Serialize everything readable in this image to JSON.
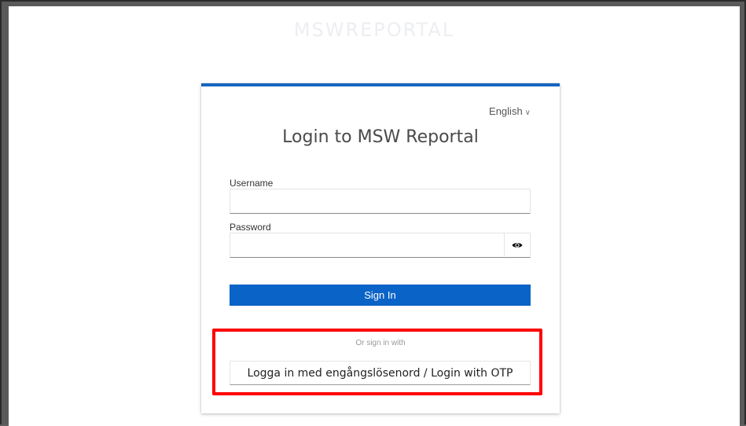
{
  "brand": {
    "text": "MSWREPORTAL"
  },
  "language": {
    "selected": "English",
    "chevron": "∨"
  },
  "login": {
    "title": "Login to MSW Reportal",
    "username_label": "Username",
    "username_value": "",
    "password_label": "Password",
    "password_value": "",
    "show_password_icon": "eye-icon",
    "signin_label": "Sign In",
    "or_text": "Or sign in with",
    "otp_label": "Logga in med engångslösenord / Login with OTP"
  },
  "colors": {
    "accent": "#1565c0",
    "signin_button": "#0a63c6",
    "highlight": "#ff0000"
  }
}
